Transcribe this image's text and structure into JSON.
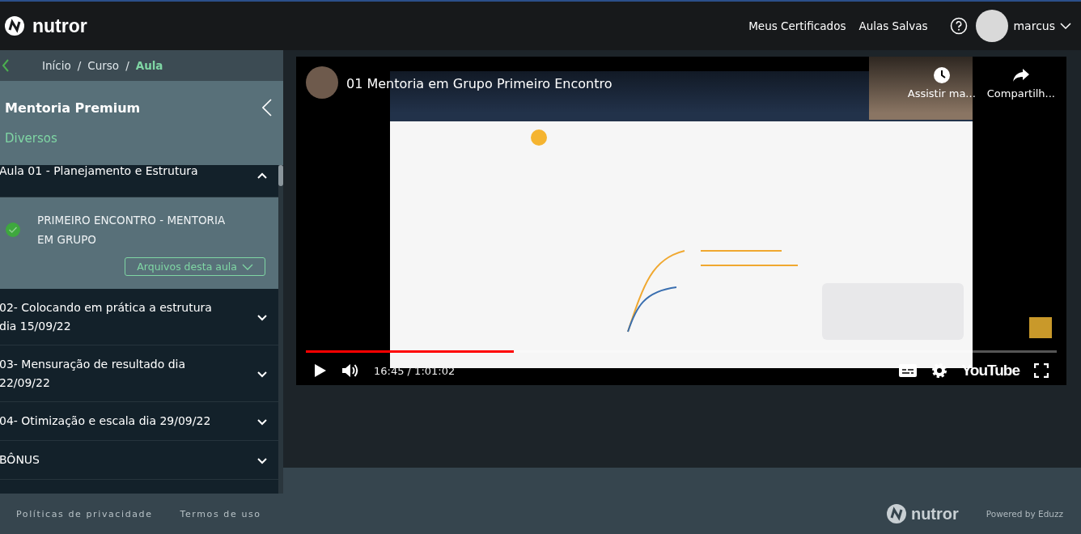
{
  "topbar": {
    "logo": "nutror",
    "nav": [
      "Meus Certificados",
      "Aulas Salvas"
    ],
    "user": "marcus"
  },
  "breadcrumb": {
    "separator": "/",
    "items": [
      {
        "label": "Início",
        "selected": false
      },
      {
        "label": "Curso",
        "selected": false
      },
      {
        "label": "Aula",
        "selected": true
      }
    ]
  },
  "course": {
    "title": "Mentoria Premium",
    "category": "Diversos"
  },
  "modules": [
    {
      "title": "Aula 01 - Planejamento e Estrutura",
      "expanded": true,
      "lessons": [
        {
          "title": "PRIMEIRO ENCONTRO - MENTORIA EM GRUPO",
          "completed": true,
          "files_button": "Arquivos desta aula"
        }
      ]
    },
    {
      "title": "02- Colocando em prática a estrutura dia 15/09/22",
      "expanded": false
    },
    {
      "title": "03- Mensuração de resultado dia 22/09/22",
      "expanded": false
    },
    {
      "title": "04- Otimização e escala dia 29/09/22",
      "expanded": false
    },
    {
      "title": "BÔNUS",
      "expanded": false
    }
  ],
  "video": {
    "title": "01 Mentoria em Grupo Primeiro Encontro",
    "watch_later": "Assistir ma...",
    "share": "Compartilh...",
    "progress": {
      "level": 0.277
    },
    "time": "16:45 / 1:01:02",
    "brand": "YouTube"
  },
  "footer": {
    "links": [
      "Políticas de privacidade",
      "Termos de uso"
    ],
    "brand": "nutror",
    "powered": "Powered by Eduzz"
  }
}
